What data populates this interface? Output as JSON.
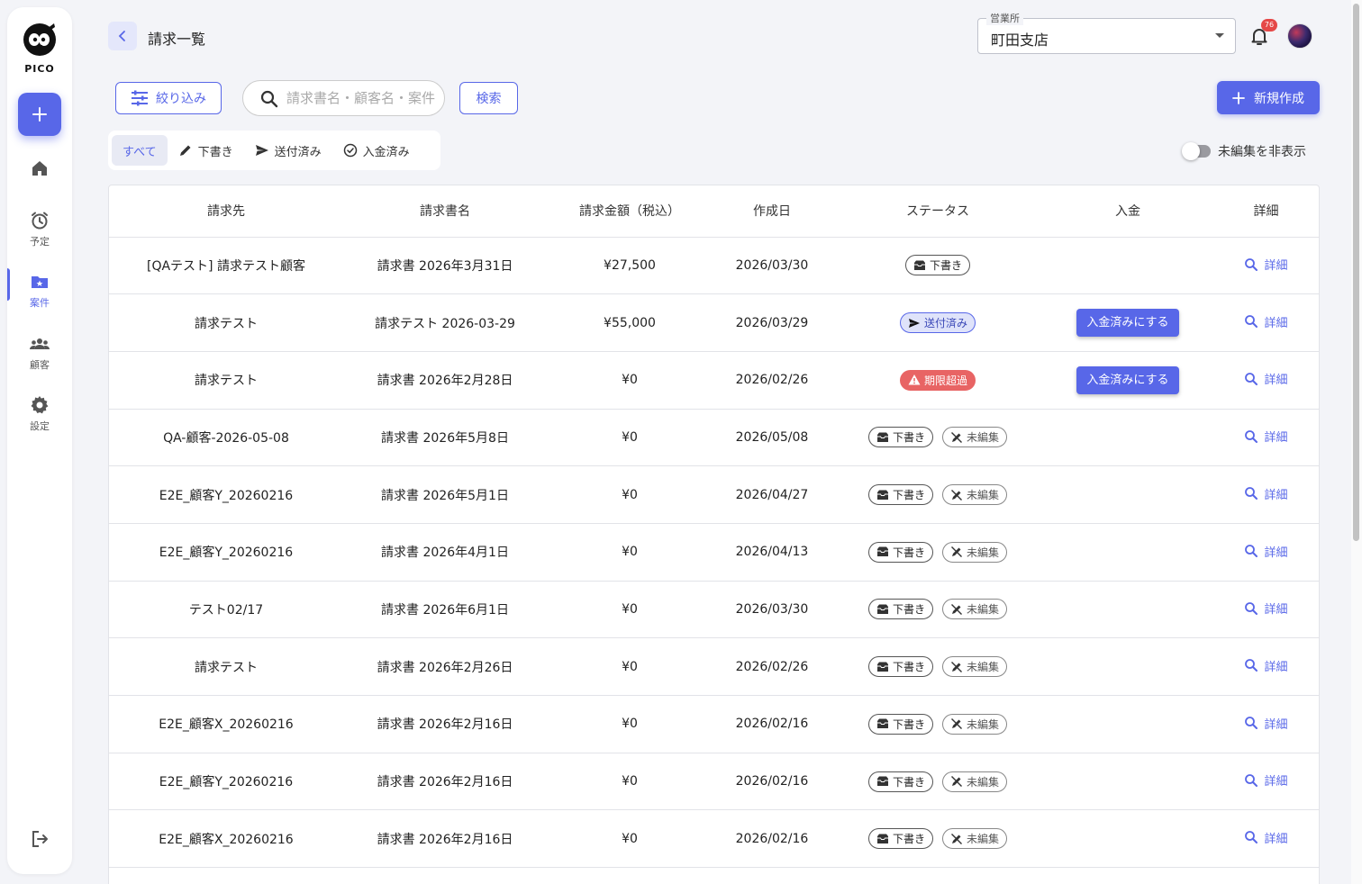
{
  "app": {
    "logo_text": "PICO"
  },
  "sidebar": {
    "items": [
      {
        "label": "",
        "icon": "home-icon"
      },
      {
        "label": "予定",
        "icon": "alarm-icon"
      },
      {
        "label": "案件",
        "icon": "folder-star-icon",
        "active": true
      },
      {
        "label": "顧客",
        "icon": "people-icon"
      },
      {
        "label": "設定",
        "icon": "gear-icon"
      }
    ]
  },
  "header": {
    "title": "請求一覧",
    "office_label": "営業所",
    "office_value": "町田支店",
    "notification_count": "76"
  },
  "toolbar": {
    "filter_label": "絞り込み",
    "search_placeholder": "請求書名・顧客名・案件",
    "search_label": "検索",
    "new_label": "新規作成"
  },
  "tabs": [
    {
      "label": "すべて",
      "active": true
    },
    {
      "label": "下書き"
    },
    {
      "label": "送付済み"
    },
    {
      "label": "入金済み"
    }
  ],
  "toggle_label": "未編集を非表示",
  "table": {
    "columns": [
      "請求先",
      "請求書名",
      "請求金額（税込）",
      "作成日",
      "ステータス",
      "入金",
      "詳細"
    ],
    "pay_label": "入金済みにする",
    "detail_label": "詳細",
    "status_labels": {
      "draft": "下書き",
      "sent": "送付済み",
      "overdue": "期限超過",
      "unedited": "未編集"
    },
    "rows": [
      {
        "client": "[QAテスト] 請求テスト顧客",
        "name": "請求書 2026年3月31日",
        "amount": "¥27,500",
        "date": "2026/03/30",
        "status": "draft",
        "unedited": false,
        "pay": false
      },
      {
        "client": "請求テスト",
        "name": "請求テスト 2026-03-29",
        "amount": "¥55,000",
        "date": "2026/03/29",
        "status": "sent",
        "unedited": false,
        "pay": true
      },
      {
        "client": "請求テスト",
        "name": "請求書 2026年2月28日",
        "amount": "¥0",
        "date": "2026/02/26",
        "status": "overdue",
        "unedited": false,
        "pay": true
      },
      {
        "client": "QA-顧客-2026-05-08",
        "name": "請求書 2026年5月8日",
        "amount": "¥0",
        "date": "2026/05/08",
        "status": "draft",
        "unedited": true,
        "pay": false
      },
      {
        "client": "E2E_顧客Y_20260216",
        "name": "請求書 2026年5月1日",
        "amount": "¥0",
        "date": "2026/04/27",
        "status": "draft",
        "unedited": true,
        "pay": false
      },
      {
        "client": "E2E_顧客Y_20260216",
        "name": "請求書 2026年4月1日",
        "amount": "¥0",
        "date": "2026/04/13",
        "status": "draft",
        "unedited": true,
        "pay": false
      },
      {
        "client": "テスト02/17",
        "name": "請求書 2026年6月1日",
        "amount": "¥0",
        "date": "2026/03/30",
        "status": "draft",
        "unedited": true,
        "pay": false
      },
      {
        "client": "請求テスト",
        "name": "請求書 2026年2月26日",
        "amount": "¥0",
        "date": "2026/02/26",
        "status": "draft",
        "unedited": true,
        "pay": false
      },
      {
        "client": "E2E_顧客X_20260216",
        "name": "請求書 2026年2月16日",
        "amount": "¥0",
        "date": "2026/02/16",
        "status": "draft",
        "unedited": true,
        "pay": false
      },
      {
        "client": "E2E_顧客Y_20260216",
        "name": "請求書 2026年2月16日",
        "amount": "¥0",
        "date": "2026/02/16",
        "status": "draft",
        "unedited": true,
        "pay": false
      },
      {
        "client": "E2E_顧客X_20260216",
        "name": "請求書 2026年2月16日",
        "amount": "¥0",
        "date": "2026/02/16",
        "status": "draft",
        "unedited": true,
        "pay": false
      }
    ]
  },
  "colors": {
    "accent": "#5867e8",
    "overdue": "#e86464",
    "sent_bg": "#dfe3fa"
  }
}
